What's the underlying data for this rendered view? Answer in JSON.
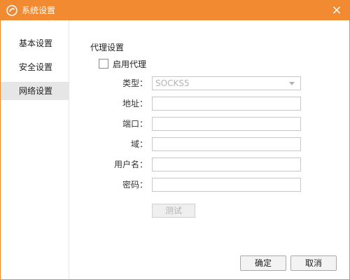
{
  "window": {
    "title": "系统设置",
    "close_glyph": "×"
  },
  "sidebar": {
    "items": [
      {
        "label": "基本设置"
      },
      {
        "label": "安全设置"
      },
      {
        "label": "网络设置"
      }
    ],
    "active_index": 2
  },
  "proxy": {
    "section_title": "代理设置",
    "enable_label": "启用代理",
    "enabled": false,
    "type_label": "类型：",
    "type_value": "SOCKS5",
    "address_label": "地址：",
    "address_value": "",
    "port_label": "端口：",
    "port_value": "",
    "domain_label": "域：",
    "domain_value": "",
    "username_label": "用户名：",
    "username_value": "",
    "password_label": "密码：",
    "password_value": "",
    "test_button": "测试"
  },
  "footer": {
    "ok_label": "确定",
    "cancel_label": "取消"
  },
  "colors": {
    "accent": "#f28a32",
    "active_sidebar_bg": "#e6e6e6",
    "disabled_text": "#b3b3b3"
  },
  "icons": {
    "app": "app-logo-icon",
    "close": "close-icon",
    "dropdown": "chevron-down-icon"
  }
}
